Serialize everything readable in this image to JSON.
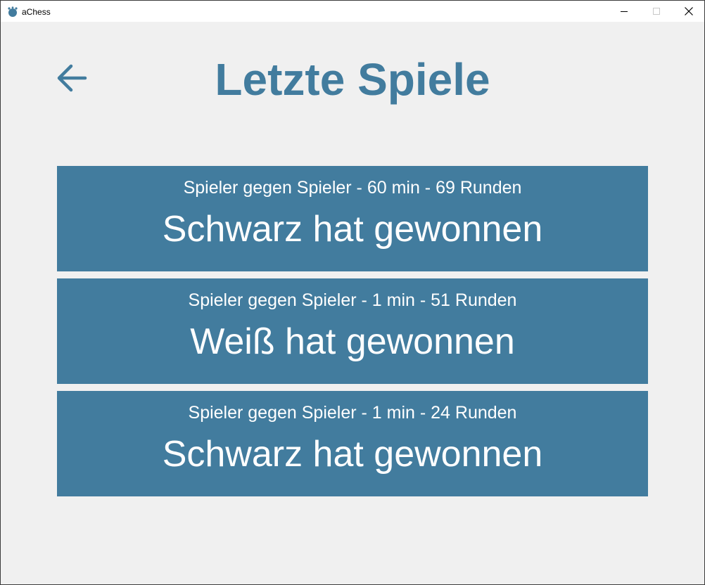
{
  "window": {
    "title": "aChess",
    "icon": "chess-pawn-icon",
    "controls": [
      "minimize-icon",
      "maximize-icon",
      "close-icon"
    ]
  },
  "header": {
    "back_icon": "arrow-left-icon",
    "title": "Letzte Spiele"
  },
  "games": [
    {
      "info": "Spieler gegen Spieler - 60 min - 69 Runden",
      "result": "Schwarz hat gewonnen"
    },
    {
      "info": "Spieler gegen Spieler - 1 min - 51 Runden",
      "result": "Weiß hat gewonnen"
    },
    {
      "info": "Spieler gegen Spieler - 1 min - 24 Runden",
      "result": "Schwarz hat gewonnen"
    }
  ],
  "colors": {
    "accent": "#427c9e",
    "background": "#f0f0f0",
    "card_text": "#ffffff"
  }
}
